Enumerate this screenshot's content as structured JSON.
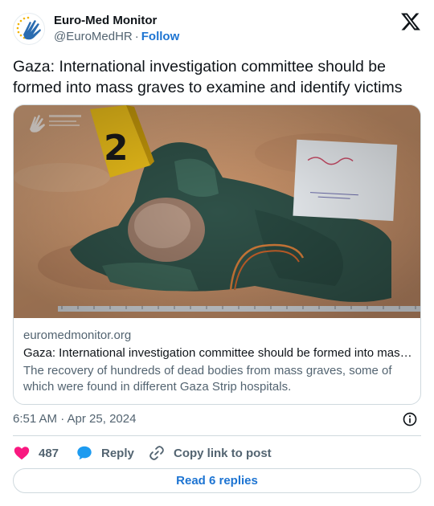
{
  "account": {
    "name": "Euro-Med Monitor",
    "handle": "@EuroMedHR",
    "separator": "·",
    "follow_label": "Follow"
  },
  "tweet": {
    "text": "Gaza: International investigation committee should be formed into mass graves to examine and identify victims",
    "timestamp": "6:51 AM · Apr 25, 2024"
  },
  "link_card": {
    "image_marker": "2",
    "domain": "euromedmonitor.org",
    "title": "Gaza: International investigation committee should be formed into mas…",
    "description": "The recovery of hundreds of dead bodies from mass graves, some of which were found in different Gaza Strip hospitals."
  },
  "actions": {
    "like_count": "487",
    "reply_label": "Reply",
    "copy_label": "Copy link to post"
  },
  "read_replies_label": "Read 6 replies",
  "colors": {
    "accent": "#1d74d2",
    "like": "#f91880",
    "muted_text": "#536471",
    "border": "#cfd9de"
  },
  "icons": [
    "euromed-logo-icon",
    "x-logo-icon",
    "info-icon",
    "heart-icon",
    "reply-bubble-icon",
    "link-icon"
  ]
}
